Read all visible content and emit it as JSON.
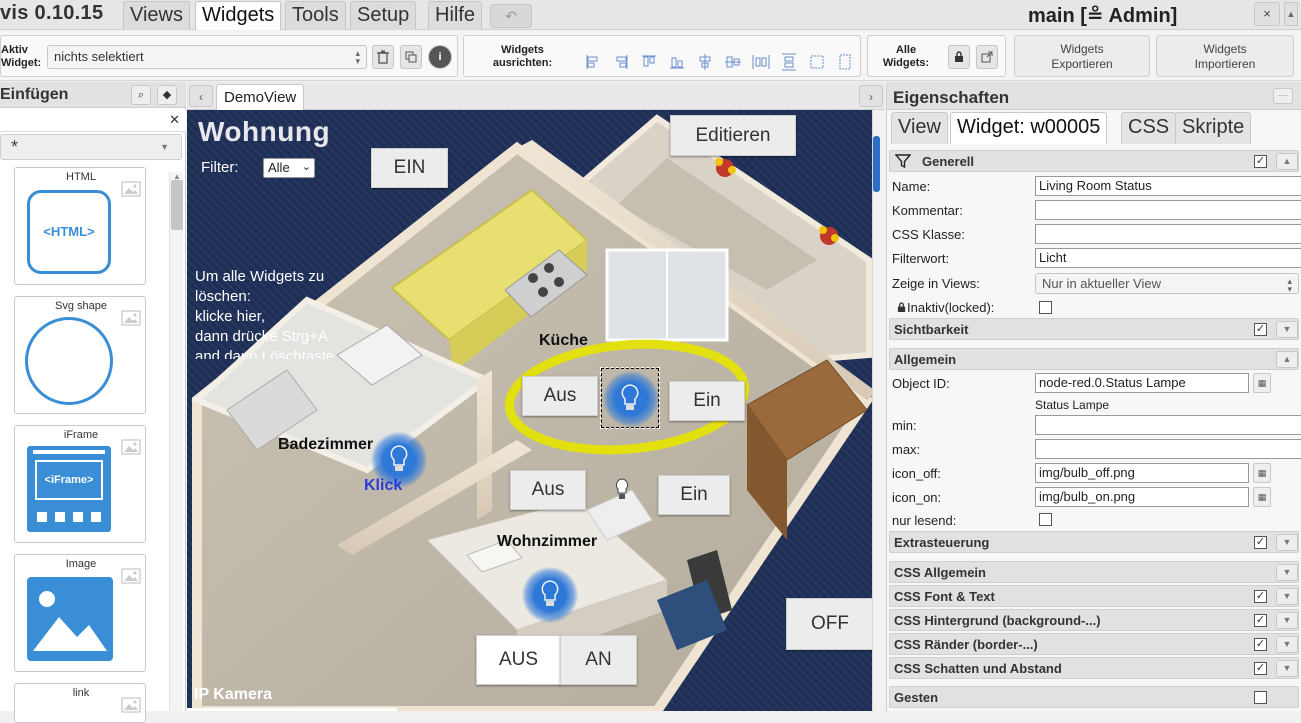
{
  "menubar": {
    "app_title": "vis 0.10.15",
    "tabs": [
      "Views",
      "Widgets",
      "Tools",
      "Setup",
      "Hilfe"
    ],
    "undo_symbol": "↶",
    "session": "main [≗ Admin]",
    "close_symbol": "×"
  },
  "toolbar": {
    "active_widget_label": "Aktiv\nWidget:",
    "active_widget_value": "nichts selektiert",
    "align_label": "Widgets\nausrichten:",
    "all_widgets_label": "Alle\nWidgets:",
    "export_label": "Widgets\nExportieren",
    "import_label": "Widgets\nImportieren"
  },
  "palette": {
    "title": "Einfügen",
    "filter_value": "",
    "category": "*",
    "items": [
      {
        "name": "HTML",
        "icon_text": "<HTML>"
      },
      {
        "name": "Svg shape"
      },
      {
        "name": "iFrame",
        "icon_text": "<iFrame>"
      },
      {
        "name": "Image"
      },
      {
        "name": "link"
      }
    ]
  },
  "editor": {
    "view_tab": "DemoView",
    "canvas": {
      "title": "Wohnung",
      "filter_label": "Filter:",
      "filter_value": "Alle",
      "edit_button": "Editieren",
      "ein_button": "EIN",
      "instruction_lines": [
        "Um alle Widgets zu",
        "löschen:",
        "klicke hier,",
        "dann drücke Strg+A",
        "and dann Löschtaste"
      ],
      "kitchen_label": "Küche",
      "kitchen_off": "Aus",
      "kitchen_on": "Ein",
      "bath_label": "Badezimmer",
      "bath_click": "Klick",
      "living_off": "Aus",
      "living_on": "Ein",
      "living_label": "Wohnzimmer",
      "aus_button": "AUS",
      "an_button": "AN",
      "off_button": "OFF",
      "camera_label": "IP Kamera"
    }
  },
  "props": {
    "title": "Eigenschaften",
    "tabs": [
      "View",
      "Widget: w00005",
      "CSS",
      "Skripte"
    ],
    "sections": {
      "generell": "Generell",
      "sichtbarkeit": "Sichtbarkeit",
      "allgemein": "Allgemein",
      "extrasteuerung": "Extrasteuerung",
      "css_allgemein": "CSS Allgemein",
      "css_font": "CSS Font & Text",
      "css_bg": "CSS Hintergrund (background-...)",
      "css_border": "CSS Ränder (border-...)",
      "css_shadow": "CSS Schatten und Abstand",
      "gesten": "Gesten"
    },
    "fields": {
      "name_label": "Name:",
      "name_value": "Living Room Status",
      "comment_label": "Kommentar:",
      "comment_value": "",
      "css_class_label": "CSS Klasse:",
      "css_class_value": "",
      "filter_label": "Filterwort:",
      "filter_value": "Licht",
      "show_views_label": "Zeige in Views:",
      "show_views_value": "Nur in aktueller View",
      "locked_label": "Inaktiv(locked):",
      "oid_label": "Object ID:",
      "oid_value": "node-red.0.Status Lampe",
      "oid_name": "Status Lampe",
      "min_label": "min:",
      "min_value": "",
      "max_label": "max:",
      "max_value": "",
      "icon_off_label": "icon_off:",
      "icon_off_value": "img/bulb_off.png",
      "icon_on_label": "icon_on:",
      "icon_on_value": "img/bulb_on.png",
      "readonly_label": "nur lesend:"
    }
  }
}
